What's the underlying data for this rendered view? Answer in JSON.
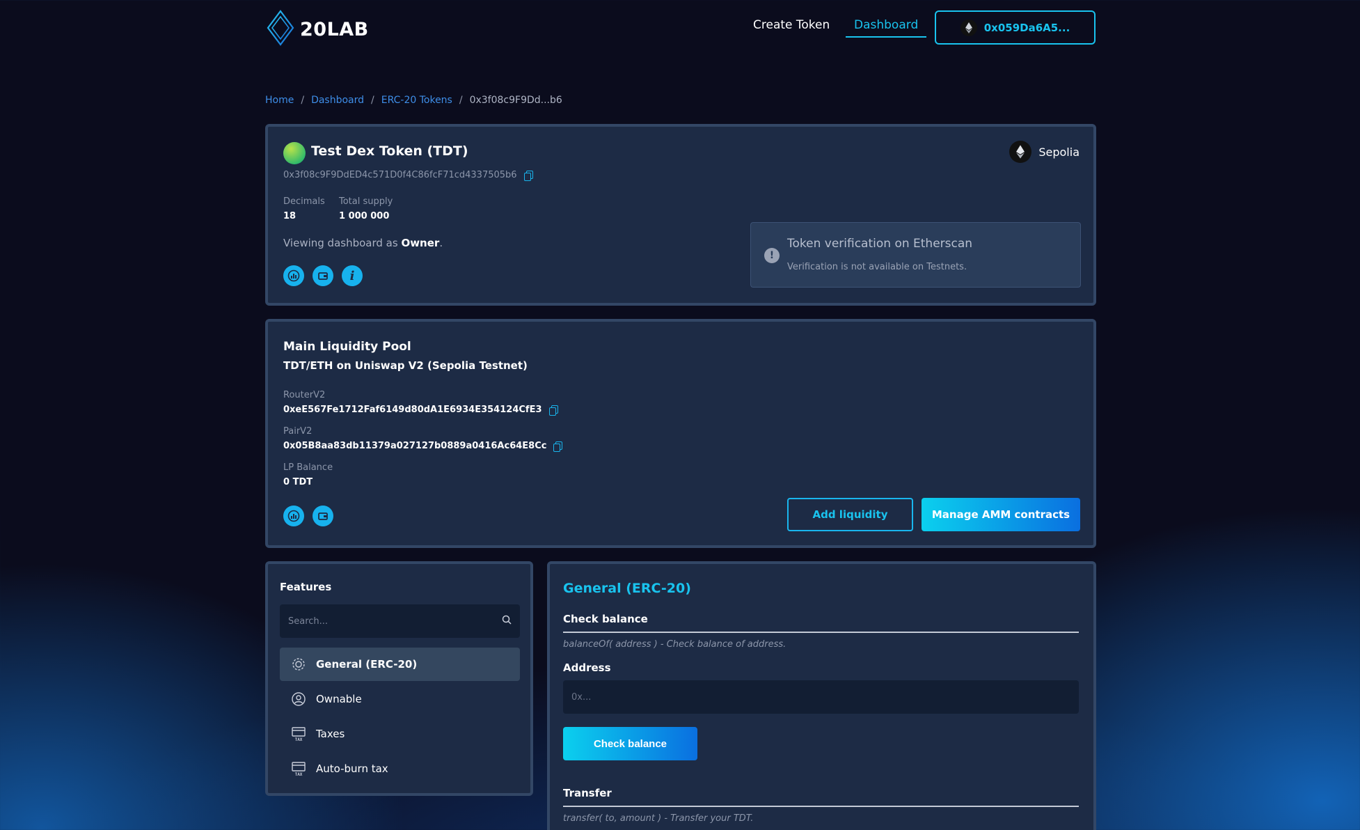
{
  "header": {
    "logo_text": "20LAB",
    "nav": {
      "create_token": "Create Token",
      "dashboard": "Dashboard"
    },
    "wallet_address": "0x059Da6A5..."
  },
  "breadcrumb": {
    "items": [
      "Home",
      "Dashboard",
      "ERC-20 Tokens"
    ],
    "current": "0x3f08c9F9Dd...b6"
  },
  "token": {
    "name": "Test Dex Token (TDT)",
    "address": "0x3f08c9F9DdED4c571D0f4C86fcF71cd4337505b6",
    "decimals_label": "Decimals",
    "decimals": "18",
    "total_supply_label": "Total supply",
    "total_supply": "1 000 000",
    "viewing_prefix": "Viewing dashboard as ",
    "viewing_role": "Owner",
    "viewing_suffix": ".",
    "network": "Sepolia",
    "verification": {
      "title": "Token verification on Etherscan",
      "message": "Verification is not available on Testnets."
    }
  },
  "pool": {
    "title": "Main Liquidity Pool",
    "subtitle": "TDT/ETH on Uniswap V2 (Sepolia Testnet)",
    "router_label": "RouterV2",
    "router": "0xeE567Fe1712Faf6149d80dA1E6934E354124CfE3",
    "pair_label": "PairV2",
    "pair": "0x05B8aa83db11379a027127b0889a0416Ac64E8Cc",
    "lp_label": "LP Balance",
    "lp_balance": "0 TDT",
    "add_liquidity": "Add liquidity",
    "manage_amm": "Manage AMM contracts"
  },
  "features": {
    "title": "Features",
    "search_placeholder": "Search...",
    "items": [
      {
        "label": "General (ERC-20)",
        "icon": "gear-icon",
        "active": true
      },
      {
        "label": "Ownable",
        "icon": "user-circle-icon",
        "active": false
      },
      {
        "label": "Taxes",
        "icon": "tax-icon",
        "active": false
      },
      {
        "label": "Auto-burn tax",
        "icon": "tax-icon",
        "active": false
      }
    ]
  },
  "general": {
    "title": "General (ERC-20)",
    "check_balance": {
      "heading": "Check balance",
      "description": "balanceOf( address ) - Check balance of address.",
      "address_label": "Address",
      "address_placeholder": "0x...",
      "button": "Check balance"
    },
    "transfer": {
      "heading": "Transfer",
      "description": "transfer( to, amount ) - Transfer your TDT."
    }
  },
  "colors": {
    "accent": "#19c3ee",
    "card_bg": "#1d2b45",
    "card_border": "#334766",
    "page_bg": "#0b0c1d"
  }
}
